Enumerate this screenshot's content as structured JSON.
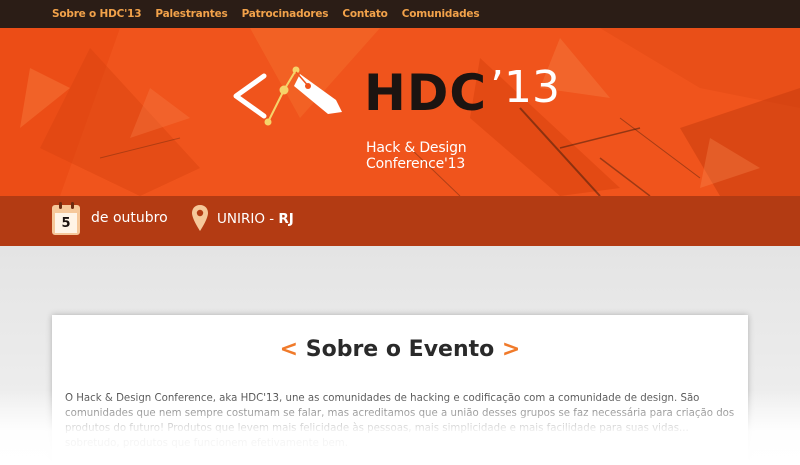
{
  "nav": {
    "items": [
      {
        "label": "Sobre o HDC'13"
      },
      {
        "label": "Palestrantes"
      },
      {
        "label": "Patrocinadores"
      },
      {
        "label": "Contato"
      },
      {
        "label": "Comunidades"
      }
    ]
  },
  "hero": {
    "logo_text": "HDC",
    "logo_year": "’13",
    "subtitle": "Hack & Design Conference'13"
  },
  "info": {
    "calendar_day": "5",
    "date_text": "de outubro",
    "place_name": "UNIRIO - ",
    "place_state": "RJ"
  },
  "section": {
    "title_open": "<",
    "title": "Sobre o Evento",
    "title_close": ">",
    "paragraph": "O Hack & Design Conference, aka HDC'13, une as comunidades de hacking e codificação com a comunidade de design. São comunidades que nem sempre costumam se falar, mas acreditamos que a união desses grupos se faz necessária para criação dos produtos do futuro! Produtos que levem mais felicidade às pessoas, mais simplicidade e mais facilidade para suas vidas... sobretudo, produtos que funcionem efetivamente bem."
  },
  "colors": {
    "nav_bg": "#2b1d16",
    "nav_link": "#f2a24a",
    "hero_bg": "#f0541c",
    "info_bg": "#b33b13",
    "accent": "#f07a2a"
  }
}
